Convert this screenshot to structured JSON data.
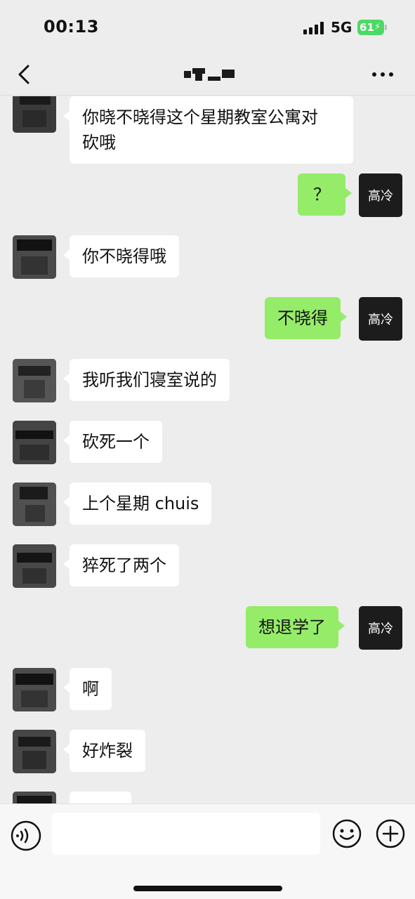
{
  "status_bar": {
    "time": "00:13",
    "network": "5G",
    "battery": "61"
  },
  "nav": {
    "title_icon": "redacted-title",
    "back_icon": "chevron-left-icon",
    "more_icon": "more-dots-icon"
  },
  "messages": [
    {
      "side": "in",
      "text": "你晓不晓得这个星期教室公寓对\n砍哦"
    },
    {
      "side": "out",
      "text": "？",
      "avatar_label": "高冷"
    },
    {
      "side": "in",
      "text": "你不晓得哦"
    },
    {
      "side": "out",
      "text": "不晓得",
      "avatar_label": "高冷"
    },
    {
      "side": "in",
      "text": "我听我们寝室说的"
    },
    {
      "side": "in",
      "text": "砍死一个"
    },
    {
      "side": "in",
      "text": "上个星期 chuis"
    },
    {
      "side": "in",
      "text": "猝死了两个"
    },
    {
      "side": "out",
      "text": "想退学了",
      "avatar_label": "高冷"
    },
    {
      "side": "in",
      "text": "啊"
    },
    {
      "side": "in",
      "text": "好炸裂"
    },
    {
      "side": "in",
      "text": ""
    }
  ],
  "input": {
    "placeholder": "",
    "value": ""
  },
  "colors": {
    "out_bubble": "#95ec69",
    "in_bubble": "#ffffff",
    "background": "#ededed",
    "battery": "#4cd964"
  }
}
